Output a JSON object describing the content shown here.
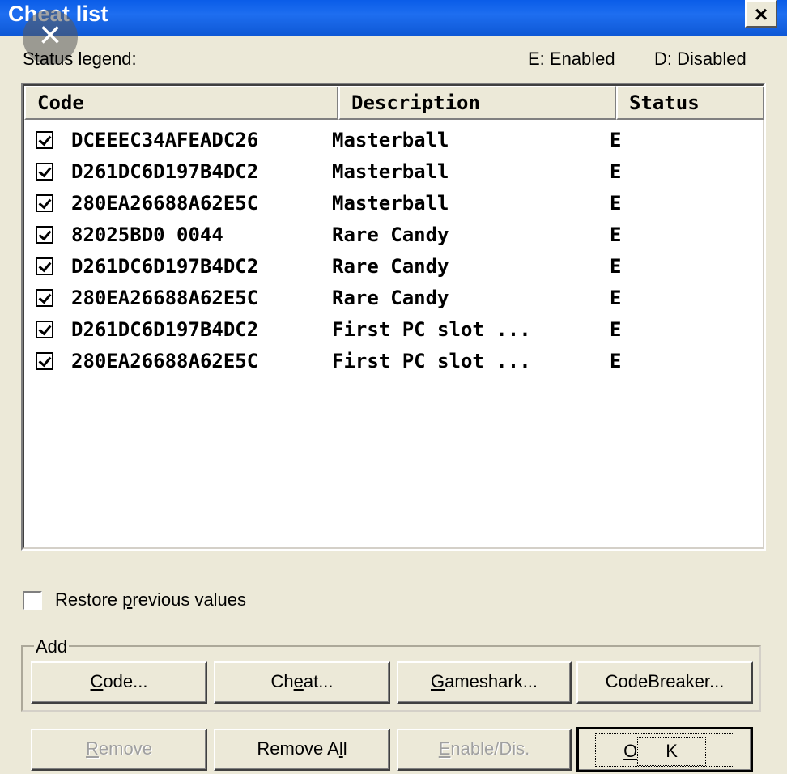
{
  "window": {
    "title": "Cheat list",
    "close_label": "×"
  },
  "overlay": {
    "close_label": "×"
  },
  "legend": {
    "label": "Status legend:",
    "enabled": "E: Enabled",
    "disabled": "D: Disabled"
  },
  "columns": {
    "code": "Code",
    "description": "Description",
    "status": "Status"
  },
  "rows": [
    {
      "code": "DCEEEC34AFEADC26",
      "description": "Masterball",
      "status": "E",
      "checked": true
    },
    {
      "code": "D261DC6D197B4DC2",
      "description": "Masterball",
      "status": "E",
      "checked": true
    },
    {
      "code": "280EA26688A62E5C",
      "description": "Masterball",
      "status": "E",
      "checked": true
    },
    {
      "code": "82025BD0 0044",
      "description": "Rare Candy",
      "status": "E",
      "checked": true
    },
    {
      "code": "D261DC6D197B4DC2",
      "description": "Rare Candy",
      "status": "E",
      "checked": true
    },
    {
      "code": "280EA26688A62E5C",
      "description": "Rare Candy",
      "status": "E",
      "checked": true
    },
    {
      "code": "D261DC6D197B4DC2",
      "description": "First PC slot ...",
      "status": "E",
      "checked": true
    },
    {
      "code": "280EA26688A62E5C",
      "description": "First PC slot ...",
      "status": "E",
      "checked": true
    }
  ],
  "restore": {
    "label_pre": "Restore ",
    "label_u": "p",
    "label_post": "revious values",
    "checked": false
  },
  "add_group": {
    "label": "Add",
    "code": {
      "u": "C",
      "rest": "ode..."
    },
    "cheat": {
      "pre": "Ch",
      "u": "e",
      "rest": "at..."
    },
    "gameshark": {
      "u": "G",
      "rest": "ameshark..."
    },
    "codebreaker": "CodeBreaker..."
  },
  "buttons": {
    "remove": {
      "u": "R",
      "rest": "emove"
    },
    "remove_all": {
      "pre": "Remove A",
      "u": "l",
      "rest": "l"
    },
    "enable": {
      "u": "E",
      "rest": "nable/Dis."
    },
    "ok": {
      "u": "O",
      "rest": "K"
    }
  }
}
